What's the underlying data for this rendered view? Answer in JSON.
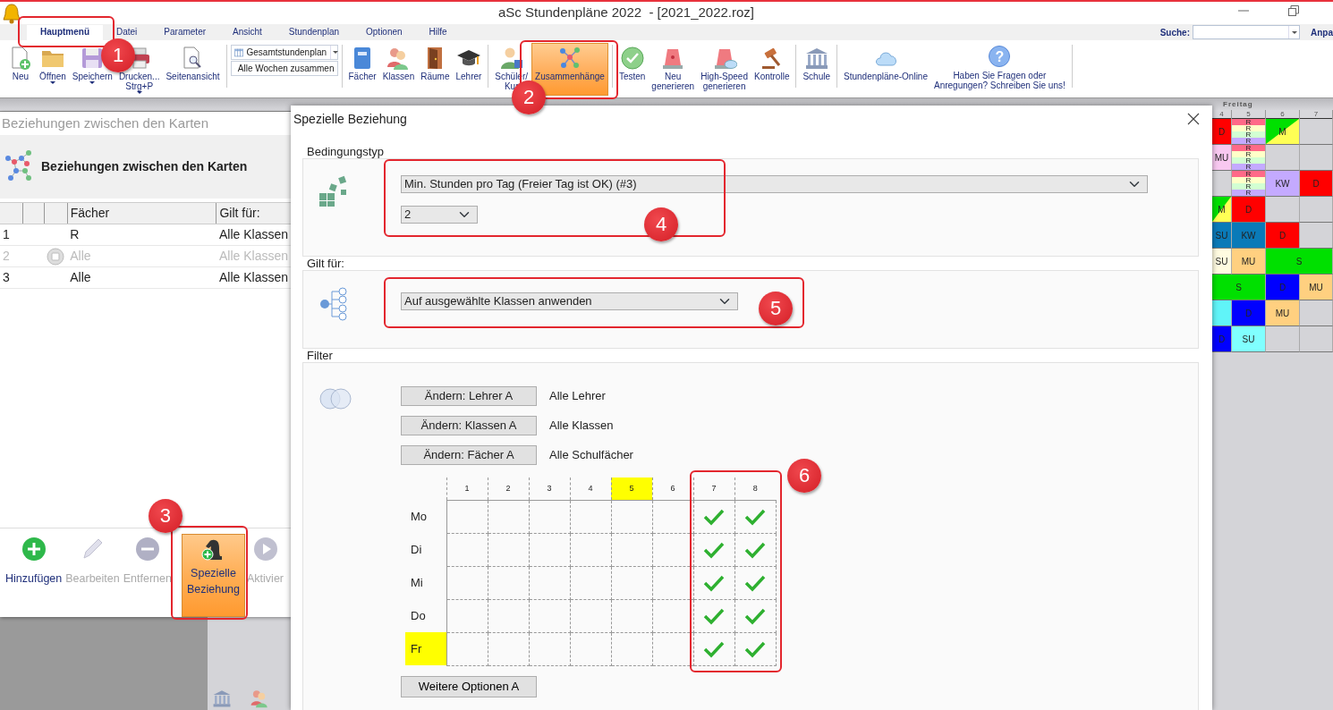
{
  "window": {
    "title": "aSc Stundenpläne 2022  - [2021_2022.roz]"
  },
  "menu_tabs": [
    {
      "label": "Hauptmenü",
      "selected": true,
      "callout": "1"
    },
    {
      "label": "Datei",
      "selected": false
    },
    {
      "label": "Parameter",
      "selected": false
    },
    {
      "label": "Ansicht",
      "selected": false
    },
    {
      "label": "Stundenplan",
      "selected": false
    },
    {
      "label": "Optionen",
      "selected": false
    },
    {
      "label": "Hilfe",
      "selected": false
    }
  ],
  "search": {
    "label": "Suche:"
  },
  "cut_label": "Anpa",
  "ribbon": [
    {
      "kind": "buttons",
      "items": [
        {
          "label": "Neu",
          "selected": false,
          "menu_arrow": false
        },
        {
          "label": "Öffnen",
          "selected": false,
          "menu_arrow": true
        },
        {
          "label": "Speichern",
          "selected": false,
          "menu_arrow": true
        },
        {
          "label": "Drucken...\nStrg+P",
          "selected": false,
          "menu_arrow": true
        },
        {
          "label": "Seitenansicht",
          "selected": false,
          "menu_arrow": false
        }
      ]
    },
    {
      "kind": "view",
      "selector": "Gesamtstundenplan",
      "option": "Alle Wochen zusammen"
    },
    {
      "kind": "buttons",
      "items": [
        {
          "label": "Fächer",
          "selected": false,
          "menu_arrow": false
        },
        {
          "label": "Klassen",
          "selected": false,
          "menu_arrow": false
        },
        {
          "label": "Räume",
          "selected": false,
          "menu_arrow": false
        },
        {
          "label": "Lehrer",
          "selected": false,
          "menu_arrow": false
        }
      ]
    },
    {
      "kind": "buttons",
      "items": [
        {
          "label": "Schüler/\nKur",
          "selected": false,
          "menu_arrow": false
        },
        {
          "label": "Zusammenhänge",
          "selected": true,
          "menu_arrow": false,
          "callout": "2"
        }
      ]
    },
    {
      "kind": "buttons",
      "items": [
        {
          "label": "Testen",
          "selected": false,
          "menu_arrow": false
        },
        {
          "label": "Neu\ngenerieren",
          "selected": false,
          "menu_arrow": false
        },
        {
          "label": "High-Speed\ngenerieren",
          "selected": false,
          "menu_arrow": false
        },
        {
          "label": "Kontrolle",
          "selected": false,
          "menu_arrow": false
        }
      ]
    },
    {
      "kind": "buttons",
      "items": [
        {
          "label": "Schule",
          "selected": false,
          "menu_arrow": false
        }
      ]
    },
    {
      "kind": "buttons",
      "items": [
        {
          "label": "Stundenpläne-Online",
          "selected": false,
          "menu_arrow": false
        },
        {
          "label": "Haben Sie Fragen oder\nAnregungen? Schreiben Sie uns!",
          "selected": false,
          "menu_arrow": false,
          "icon_text": "?"
        }
      ]
    }
  ],
  "timetable": {
    "day": "Freitag",
    "periods": [
      "4",
      "5",
      "6",
      "7"
    ],
    "rows": [
      [
        {
          "text": "D",
          "color": "#ff0000"
        },
        {
          "kind": "stack",
          "parts": [
            {
              "text": "R",
              "color": "#ff6a88"
            },
            {
              "text": "R",
              "color": "#ffffc8"
            },
            {
              "text": "R",
              "color": "#d2ffd2"
            },
            {
              "text": "R",
              "color": "#c4aaff"
            }
          ]
        },
        {
          "kind": "split",
          "text": "M",
          "parts": [
            {
              "color": "#00e000"
            },
            {
              "color": "#ffff55"
            }
          ]
        },
        {
          "kind": "empty"
        }
      ],
      [
        {
          "text": "MU",
          "color": "#f8c8f0"
        },
        {
          "kind": "stack",
          "parts": [
            {
              "text": "R",
              "color": "#ff6a88"
            },
            {
              "text": "R",
              "color": "#ffffc8"
            },
            {
              "text": "R",
              "color": "#d2ffd2"
            },
            {
              "text": "R",
              "color": "#c4aaff"
            }
          ]
        },
        {
          "kind": "empty"
        },
        {
          "kind": "empty"
        }
      ],
      [
        {
          "kind": "empty"
        },
        {
          "kind": "stack",
          "parts": [
            {
              "text": "R",
              "color": "#ff6a88"
            },
            {
              "text": "R",
              "color": "#ffffc8"
            },
            {
              "text": "R",
              "color": "#d2ffd2"
            },
            {
              "text": "R",
              "color": "#c4aaff"
            }
          ]
        },
        {
          "text": "KW",
          "color": "#c4aaff"
        },
        {
          "text": "D",
          "color": "#ff0000"
        }
      ],
      [
        {
          "kind": "split",
          "text": "M",
          "parts": [
            {
              "color": "#00e000"
            },
            {
              "color": "#ffff55"
            }
          ]
        },
        {
          "text": "D",
          "color": "#ff0000"
        },
        {
          "kind": "empty"
        },
        {
          "kind": "empty"
        }
      ],
      [
        {
          "text": "SU",
          "color": "#0a7ab8"
        },
        {
          "text": "KW",
          "color": "#0a7ab8"
        },
        {
          "text": "D",
          "color": "#ff0000"
        },
        {
          "kind": "empty"
        }
      ],
      [
        {
          "text": "SU",
          "color": "#fffbe0"
        },
        {
          "text": "MU",
          "color": "#ffd080"
        },
        {
          "kind": "double",
          "text": "S",
          "color": "#00e000"
        },
        {
          "kind": "continued"
        }
      ],
      [
        {
          "kind": "double",
          "text": "S",
          "color": "#00e000"
        },
        {
          "kind": "continued"
        },
        {
          "text": "D",
          "color": "#0000ff"
        },
        {
          "text": "MU",
          "color": "#ffd080"
        }
      ],
      [
        {
          "color": "#60f4f8"
        },
        {
          "text": "D",
          "color": "#0000ff"
        },
        {
          "text": "MU",
          "color": "#ffd080"
        },
        {
          "kind": "empty"
        }
      ],
      [
        {
          "text": "D",
          "color": "#0000ff"
        },
        {
          "text": "SU",
          "color": "#80ffff"
        },
        {
          "kind": "empty"
        },
        {
          "kind": "empty"
        }
      ]
    ]
  },
  "relations_panel": {
    "title": "Beziehungen zwischen den Karten",
    "heading": "Beziehungen zwischen den Karten",
    "columns": [
      "Fächer",
      "Gilt für:"
    ],
    "rows": [
      {
        "number": "1",
        "subject": "R",
        "applies_to": "Alle Klassen",
        "disabled": false
      },
      {
        "number": "2",
        "subject": "Alle",
        "applies_to": "Alle Klassen",
        "disabled": true
      },
      {
        "number": "3",
        "subject": "Alle",
        "applies_to": "Alle Klassen",
        "disabled": false
      }
    ],
    "toolbar": [
      {
        "label": "Hinzufügen",
        "disabled": false,
        "selected": false
      },
      {
        "label": "Bearbeiten",
        "disabled": true,
        "selected": false
      },
      {
        "label": "Entfernen",
        "disabled": true,
        "selected": false
      },
      {
        "label": "Spezielle\nBeziehung",
        "disabled": false,
        "selected": true,
        "callout": "3"
      },
      {
        "label": "Aktivier",
        "disabled": true,
        "selected": false
      }
    ]
  },
  "dialog": {
    "title": "Spezielle Beziehung",
    "condition": {
      "legend": "Bedingungstyp",
      "type": "Min. Stunden pro Tag (Freier Tag ist OK) (#3)",
      "count": "2",
      "callout": "4"
    },
    "applies": {
      "legend": "Gilt für:",
      "value": "Auf ausgewählte Klassen anwenden",
      "callout": "5"
    },
    "filter": {
      "legend": "Filter",
      "rows": [
        {
          "button": "Ändern: Lehrer A",
          "value": "Alle Lehrer"
        },
        {
          "button": "Ändern: Klassen A",
          "value": "Alle Klassen"
        },
        {
          "button": "Ändern: Fächer A",
          "value": "Alle Schulfächer"
        }
      ],
      "grid": {
        "callout": "6",
        "periods": [
          {
            "label": "1",
            "highlighted": false
          },
          {
            "label": "2",
            "highlighted": false
          },
          {
            "label": "3",
            "highlighted": false
          },
          {
            "label": "4",
            "highlighted": false
          },
          {
            "label": "5",
            "highlighted": true
          },
          {
            "label": "6",
            "highlighted": false
          },
          {
            "label": "7",
            "highlighted": false
          },
          {
            "label": "8",
            "highlighted": false
          }
        ],
        "days": [
          {
            "label": "Mo",
            "highlighted": false,
            "cells": [
              {
                "checked": false
              },
              {
                "checked": false
              },
              {
                "checked": false
              },
              {
                "checked": false
              },
              {
                "checked": false
              },
              {
                "checked": false
              },
              {
                "checked": true
              },
              {
                "checked": true
              }
            ]
          },
          {
            "label": "Di",
            "highlighted": false,
            "cells": [
              {
                "checked": false
              },
              {
                "checked": false
              },
              {
                "checked": false
              },
              {
                "checked": false
              },
              {
                "checked": false
              },
              {
                "checked": false
              },
              {
                "checked": true
              },
              {
                "checked": true
              }
            ]
          },
          {
            "label": "Mi",
            "highlighted": false,
            "cells": [
              {
                "checked": false
              },
              {
                "checked": false
              },
              {
                "checked": false
              },
              {
                "checked": false
              },
              {
                "checked": false
              },
              {
                "checked": false
              },
              {
                "checked": true
              },
              {
                "checked": true
              }
            ]
          },
          {
            "label": "Do",
            "highlighted": false,
            "cells": [
              {
                "checked": false
              },
              {
                "checked": false
              },
              {
                "checked": false
              },
              {
                "checked": false
              },
              {
                "checked": false
              },
              {
                "checked": false
              },
              {
                "checked": true
              },
              {
                "checked": true
              }
            ]
          },
          {
            "label": "Fr",
            "highlighted": true,
            "cells": [
              {
                "checked": false
              },
              {
                "checked": false
              },
              {
                "checked": false
              },
              {
                "checked": false
              },
              {
                "checked": false
              },
              {
                "checked": false
              },
              {
                "checked": true
              },
              {
                "checked": true
              }
            ]
          }
        ]
      },
      "more_button": "Weitere Optionen A"
    }
  }
}
